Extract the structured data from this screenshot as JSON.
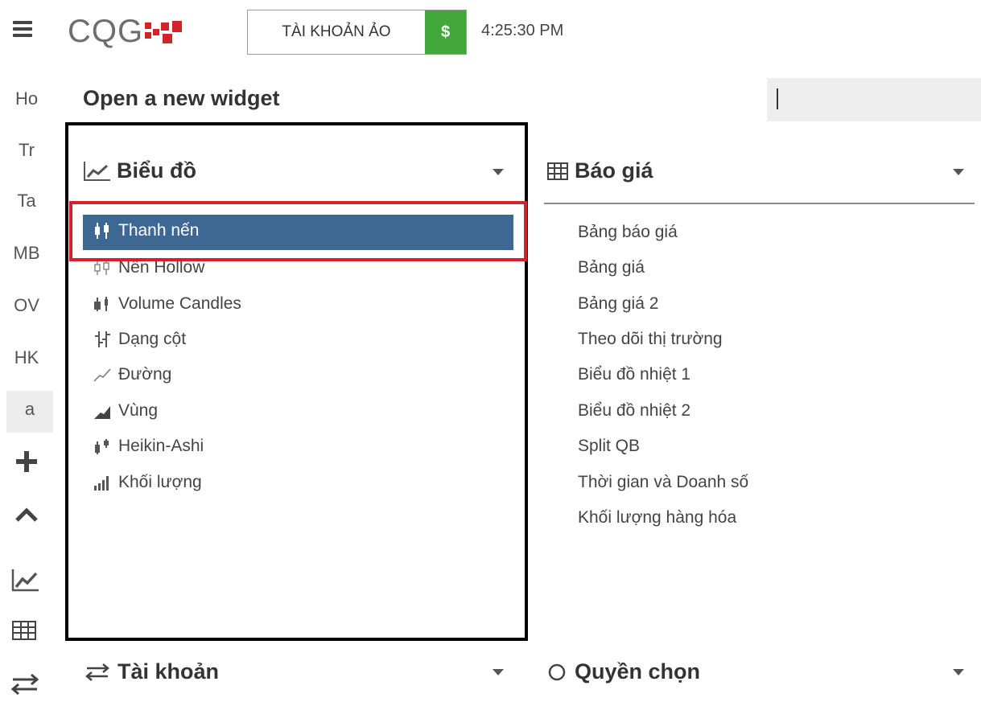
{
  "header": {
    "logo_text": "CQG",
    "account_label": "TÀI KHOẢN ẢO",
    "dollar_symbol": "$",
    "time": "4:25:30 PM"
  },
  "rail": {
    "items": [
      "Ho",
      "Tr",
      "Ta",
      "MB",
      "OV",
      "HK",
      "a"
    ]
  },
  "page": {
    "title": "Open a new widget",
    "search_value": ""
  },
  "charts": {
    "title": "Biểu đồ",
    "items": [
      "Thanh nến",
      "Nến Hollow",
      "Volume Candles",
      "Dạng cột",
      "Đường",
      "Vùng",
      "Heikin-Ashi",
      "Khối lượng"
    ],
    "selected_index": 0
  },
  "quotes": {
    "title": "Báo giá",
    "items": [
      "Bảng báo giá",
      "Bảng giá",
      "Bảng giá 2",
      "Theo dõi thị trường",
      "Biểu đồ nhiệt 1",
      "Biểu đồ nhiệt 2",
      "Split QB",
      "Thời gian và Doanh số",
      "Khối lượng hàng hóa"
    ]
  },
  "accounts": {
    "title": "Tài khoản"
  },
  "options": {
    "title": "Quyền chọn"
  },
  "colors": {
    "selected_row": "#3d6894",
    "highlight_frame": "#d2232a",
    "dollar_button": "#43a83c",
    "logo_red": "#d2232a"
  },
  "icons": {
    "menu": "hamburger-icon",
    "chart_section": "line-chart-icon",
    "quote_section": "grid-table-icon",
    "account_section": "transfer-arrows-icon",
    "options_section": "circle-icon"
  }
}
